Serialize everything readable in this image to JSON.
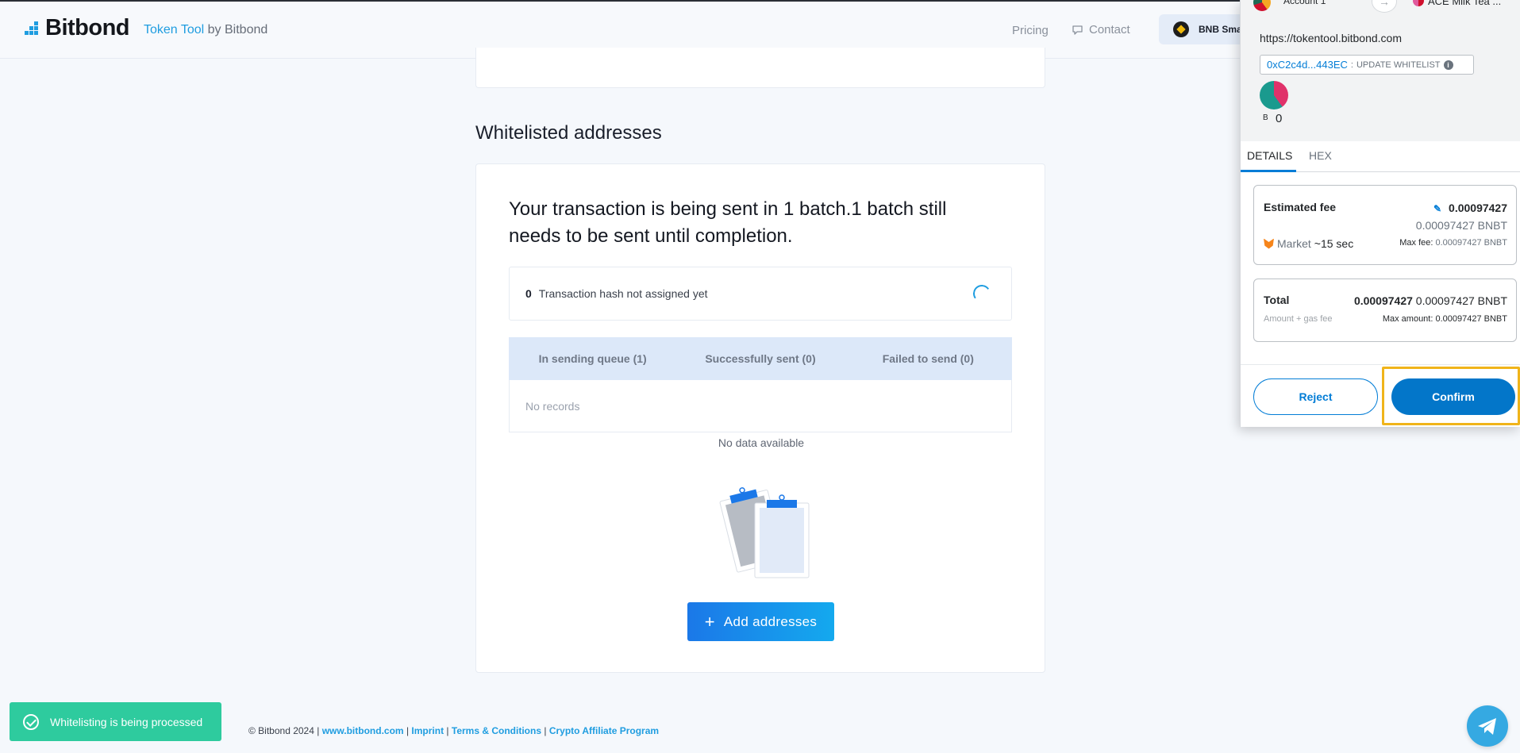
{
  "header": {
    "logo_text": "Bitbond",
    "product_name": "Token Tool",
    "product_by": "by Bitbond",
    "nav": {
      "pricing": "Pricing",
      "contact": "Contact"
    },
    "chain_button": "BNB Sma"
  },
  "main": {
    "section_title": "Whitelisted addresses",
    "tx_title": "Your transaction is being sent in 1 batch.1 batch still needs to be sent until completion.",
    "tx_row": {
      "count": "0",
      "text": "Transaction hash not assigned yet"
    },
    "tabs": [
      {
        "label": "In sending queue (1)"
      },
      {
        "label": "Successfully sent (0)"
      },
      {
        "label": "Failed to send (0)"
      }
    ],
    "records_empty": "No records",
    "no_data": "No data available",
    "add_button": {
      "icon": "+",
      "label": "Add addresses"
    }
  },
  "footer": {
    "copyright": "© Bitbond 2024 |",
    "links": [
      {
        "text": "www.bitbond.com"
      },
      {
        "text": "Imprint"
      },
      {
        "text": "Terms & Conditions"
      },
      {
        "text": "Crypto Affiliate Program"
      }
    ],
    "sep": "|"
  },
  "toast": {
    "text": "Whitelisting is being processed",
    "color": "#2ecb9e"
  },
  "metamask": {
    "account_from": "Account 1",
    "account_to": "ACE Milk Tea ...",
    "origin": "https://tokentool.bitbond.com",
    "address": "0xC2c4d...443EC",
    "address_sep": ":",
    "action": "UPDATE WHITELIST",
    "token_symbol": "B",
    "token_amount": "0",
    "tabs": [
      "DETAILS",
      "HEX"
    ],
    "estimated_fee": {
      "label": "Estimated fee",
      "value": "0.00097427",
      "value_sub": "0.00097427 BNBT",
      "market_label": "Market",
      "market_time": "~15 sec",
      "max_fee_label": "Max fee:",
      "max_fee_value": "0.00097427 BNBT"
    },
    "total": {
      "label": "Total",
      "value_bold": "0.00097427",
      "value_rest": "0.00097427 BNBT",
      "sub_label": "Amount + gas fee",
      "max_amount_label": "Max amount:",
      "max_amount_value": "0.00097427 BNBT"
    },
    "reject": "Reject",
    "confirm": "Confirm",
    "accent_color": "#037dd6",
    "highlight_color": "#f0b41a"
  }
}
